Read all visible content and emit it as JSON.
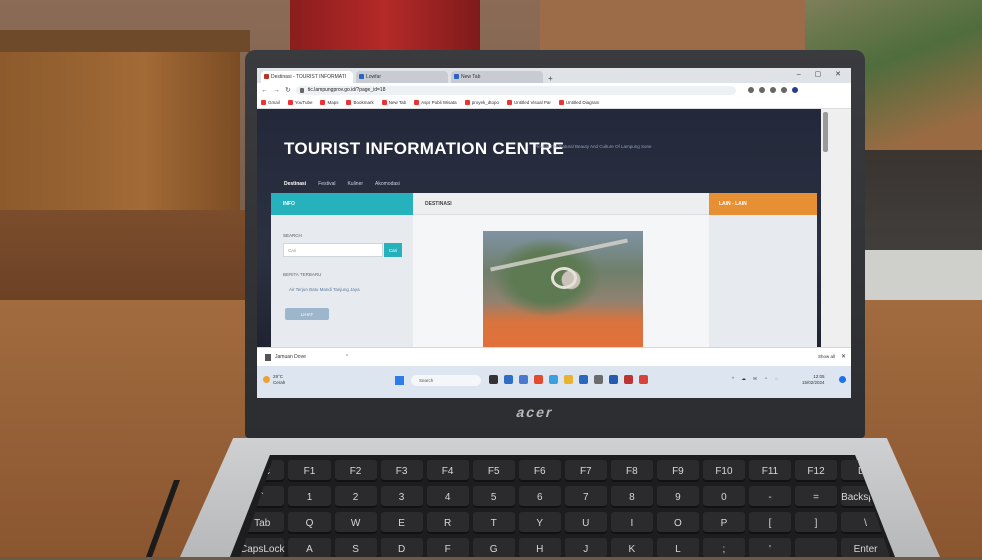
{
  "browser": {
    "tabs": [
      {
        "label": "Destinasi - TOURIST INFORMATI",
        "active": true
      },
      {
        "label": "Lowfar",
        "active": false
      },
      {
        "label": "New Tab",
        "active": false
      }
    ],
    "new_tab": "+",
    "window_controls": "– ▢ ✕",
    "url": "tic.lampungprov.go.id/?page_id=18",
    "bookmarks": [
      "Gmail",
      "YouTube",
      "Maps",
      "Bookmark",
      "New Tab",
      "Aspr Publi Wisata",
      "proyek_dtopo",
      "Untitled Visual Par",
      "Untitled Diagram"
    ]
  },
  "site": {
    "title": "TOURIST INFORMATION CENTRE",
    "tagline": "Reveal The Natural Beauty And Culture Of Lampung Sone",
    "nav": [
      "Destinasi",
      "Festival",
      "Kuliner",
      "Akomodasi"
    ],
    "info": {
      "header": "INFO",
      "search_label": "SEARCH",
      "search_placeholder": "Cari",
      "search_button": "Cari",
      "recent_header": "BERITA TERBARU",
      "recent_item": "Air Terjun Batu Mandi Tanjung Jaya",
      "badge": "LIHAT"
    },
    "destinasi": {
      "header": "DESTINASI"
    },
    "lain": {
      "header": "LAIN - LAIN"
    }
  },
  "downloads": {
    "file": "Jamuan Dove",
    "show_all": "Show all",
    "close": "✕"
  },
  "taskbar": {
    "weather_temp": "29°C",
    "weather_desc": "Cerah",
    "search": "Search",
    "tray": "^ ☁ ✉ ⚬ ◌",
    "time": "12:05",
    "date": "15/02/2024"
  },
  "laptop": {
    "brand": "acer"
  },
  "keyboard": {
    "keys": [
      "esc",
      "F1",
      "F2",
      "F3",
      "F4",
      "F5",
      "F6",
      "F7",
      "F8",
      "F9",
      "F10",
      "F11",
      "F12",
      "Del",
      "`",
      "1",
      "2",
      "3",
      "4",
      "5",
      "6",
      "7",
      "8",
      "9",
      "0",
      "-",
      "=",
      "Backspace",
      "Tab",
      "Q",
      "W",
      "E",
      "R",
      "T",
      "Y",
      "U",
      "I",
      "O",
      "P",
      "[",
      "]",
      "\\",
      "CapsLock",
      "A",
      "S",
      "D",
      "F",
      "G",
      "H",
      "J",
      "K",
      "L",
      ";",
      "'",
      "",
      "Enter"
    ]
  },
  "colors": {
    "teal": "#26b2bd",
    "orange": "#e69033",
    "header_bg": "#23283a"
  }
}
